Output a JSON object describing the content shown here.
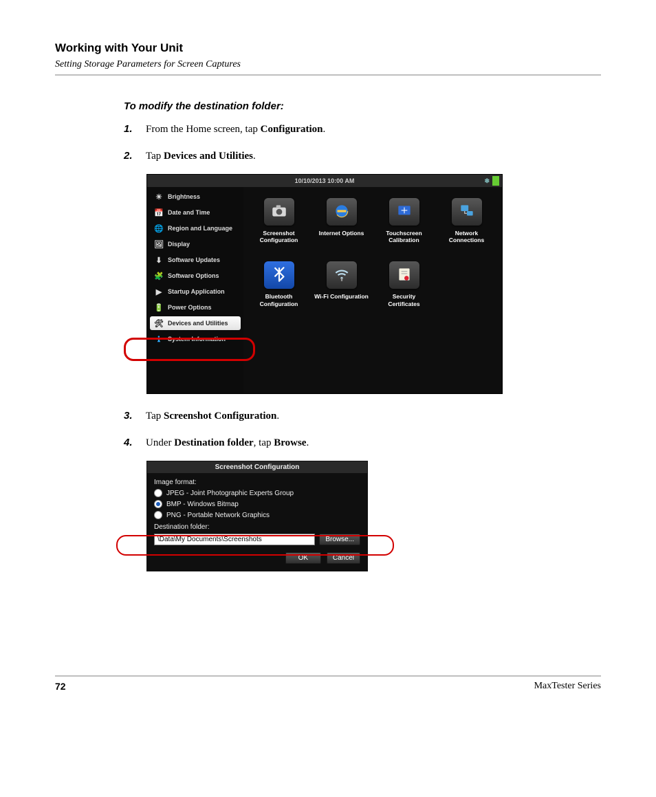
{
  "header": {
    "chapter": "Working with Your Unit",
    "section": "Setting Storage Parameters for Screen Captures"
  },
  "procedure": {
    "title": "To modify the destination folder:",
    "steps": [
      {
        "prefix": "From the Home screen, tap ",
        "bold": "Configuration",
        "suffix": "."
      },
      {
        "prefix": "Tap ",
        "bold": "Devices and Utilities",
        "suffix": "."
      },
      {
        "prefix": "Tap ",
        "bold": "Screenshot Configuration",
        "suffix": "."
      },
      {
        "prefix": "Under ",
        "bold": "Destination folder",
        "mid": ", tap ",
        "bold2": "Browse",
        "suffix": "."
      }
    ]
  },
  "screenshot1": {
    "datetime": "10/10/2013 10:00 AM",
    "sidebar": [
      "Brightness",
      "Date and Time",
      "Region and Language",
      "Display",
      "Software Updates",
      "Software Options",
      "Startup Application",
      "Power Options",
      "Devices and Utilities",
      "System Information"
    ],
    "tiles": [
      "Screenshot Configuration",
      "Internet Options",
      "Touchscreen Calibration",
      "Network Connections",
      "Bluetooth Configuration",
      "Wi-Fi Configuration",
      "Security Certificates"
    ]
  },
  "screenshot2": {
    "title": "Screenshot Configuration",
    "image_format_label": "Image format:",
    "options": [
      "JPEG - Joint Photographic Experts Group",
      "BMP - Windows Bitmap",
      "PNG - Portable Network Graphics"
    ],
    "selected_index": 1,
    "dest_label": "Destination folder:",
    "dest_path": "\\Data\\My Documents\\Screenshots",
    "browse": "Browse...",
    "ok": "OK",
    "cancel": "Cancel"
  },
  "footer": {
    "page": "72",
    "series": "MaxTester Series"
  },
  "colors": {
    "highlight": "#d20000"
  }
}
